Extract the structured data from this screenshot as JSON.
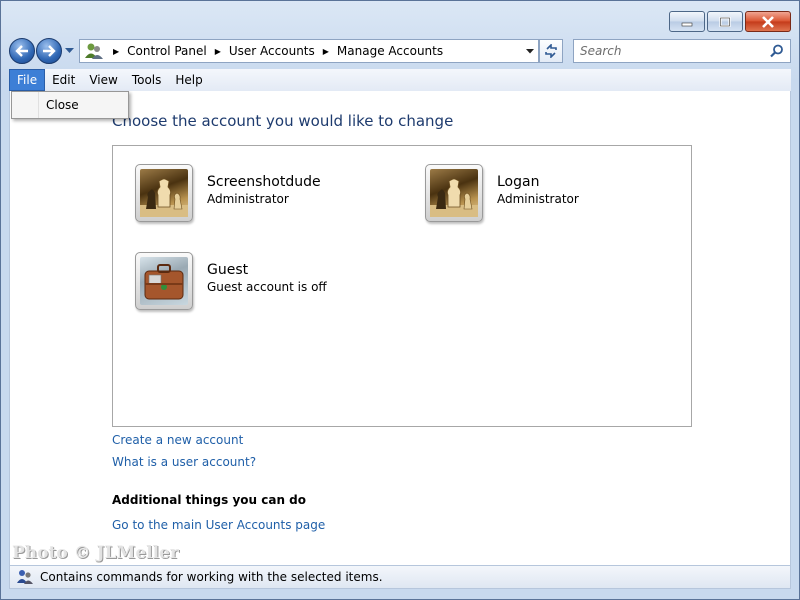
{
  "window": {
    "caption_buttons": [
      "minimize",
      "maximize",
      "close"
    ]
  },
  "nav": {
    "breadcrumbs": [
      "Control Panel",
      "User Accounts",
      "Manage Accounts"
    ],
    "search_placeholder": "Search"
  },
  "menubar": {
    "items": [
      "File",
      "Edit",
      "View",
      "Tools",
      "Help"
    ],
    "active": "File"
  },
  "file_menu": {
    "items": [
      "Close"
    ]
  },
  "main": {
    "heading": "Choose the account you would like to change",
    "accounts": [
      {
        "name": "Screenshotdude",
        "role": "Administrator",
        "avatar": "chess-pieces-icon"
      },
      {
        "name": "Logan",
        "role": "Administrator",
        "avatar": "chess-pieces-icon"
      },
      {
        "name": "Guest",
        "role": "Guest account is off",
        "avatar": "suitcase-icon"
      }
    ],
    "links": {
      "create": "Create a new account",
      "what_is": "What is a user account?"
    },
    "additional_heading": "Additional things you can do",
    "additional_link": "Go to the main User Accounts page"
  },
  "watermark": "Photo © JLMeller",
  "status": {
    "text": "Contains commands for working with the selected items."
  },
  "colors": {
    "link": "#1f5fa8",
    "heading": "#1e3b6e",
    "menu_active": "#3d7fd6"
  }
}
